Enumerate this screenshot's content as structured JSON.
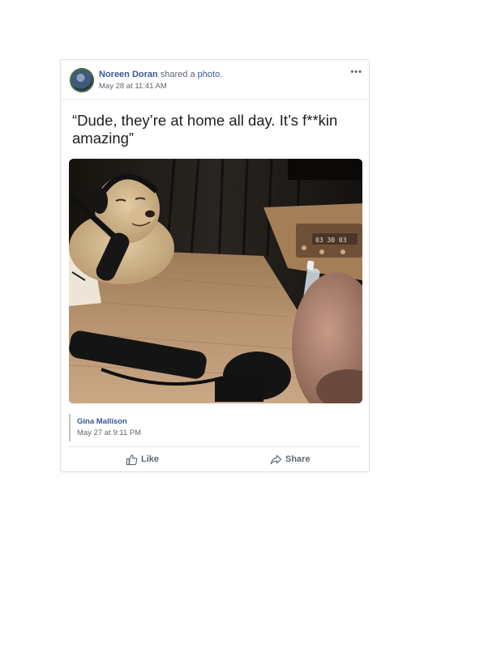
{
  "post": {
    "author": "Noreen Doran",
    "action_text": " shared a ",
    "object_link": "photo",
    "trailing": ".",
    "timestamp": "May 28 at 11:41 AM",
    "more_label": "•••",
    "caption": "“Dude, they’re at home all day. It’s f**kin amazing”"
  },
  "shared_from": {
    "name": "Gina Mallison",
    "timestamp": "May 27 at 9:11 PM"
  },
  "actions": {
    "like_label": "Like",
    "share_label": "Share"
  },
  "photo": {
    "clock_display": "03 30 03"
  },
  "icons": {
    "like": "thumbs-up-icon",
    "share": "share-arrow-icon",
    "more": "more-dots-icon"
  },
  "colors": {
    "link": "#385898",
    "text": "#1c1e21",
    "secondary": "#606770"
  }
}
